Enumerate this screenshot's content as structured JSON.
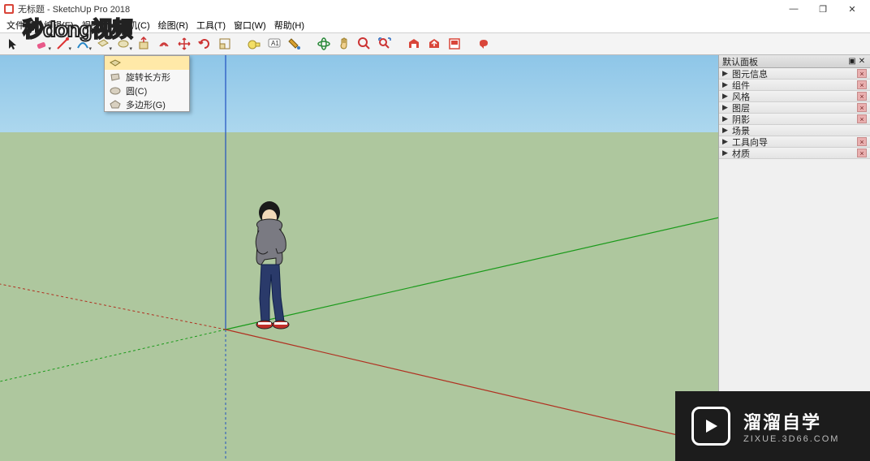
{
  "window": {
    "title": "无标题 - SketchUp Pro 2018",
    "minimize": "—",
    "maximize": "❐",
    "close": "✕"
  },
  "menu": {
    "items": [
      "文件(F)",
      "编辑(E)",
      "视图(V)",
      "相机(C)",
      "绘图(R)",
      "工具(T)",
      "窗口(W)",
      "帮助(H)"
    ]
  },
  "dropdown": {
    "items": [
      {
        "label": "",
        "icon": "rect",
        "highlight": true
      },
      {
        "label": "旋转长方形",
        "icon": "rot-rect"
      },
      {
        "label": "圆(C)",
        "icon": "circle"
      },
      {
        "label": "多边形(G)",
        "icon": "polygon"
      }
    ]
  },
  "side": {
    "title": "默认面板",
    "rows": [
      {
        "label": "图元信息",
        "x": true
      },
      {
        "label": "组件",
        "x": true
      },
      {
        "label": "风格",
        "x": true
      },
      {
        "label": "图层",
        "x": true
      },
      {
        "label": "阴影",
        "x": true
      },
      {
        "label": "场景",
        "x": false
      },
      {
        "label": "工具向导",
        "x": true
      },
      {
        "label": "材质",
        "x": true
      }
    ]
  },
  "brand": {
    "big": "溜溜自学",
    "small": "ZIXUE.3D66.COM"
  },
  "logo": "秒dong视频",
  "toolbar_icons": [
    "select",
    "eraser",
    "line",
    "arc",
    "rect",
    "circle",
    "pushpull",
    "offset",
    "move",
    "rotate",
    "scale",
    "tape",
    "text",
    "paint",
    "orbit",
    "pan",
    "zoom",
    "zoom-extents",
    "3dw",
    "send",
    "import",
    "extension"
  ]
}
